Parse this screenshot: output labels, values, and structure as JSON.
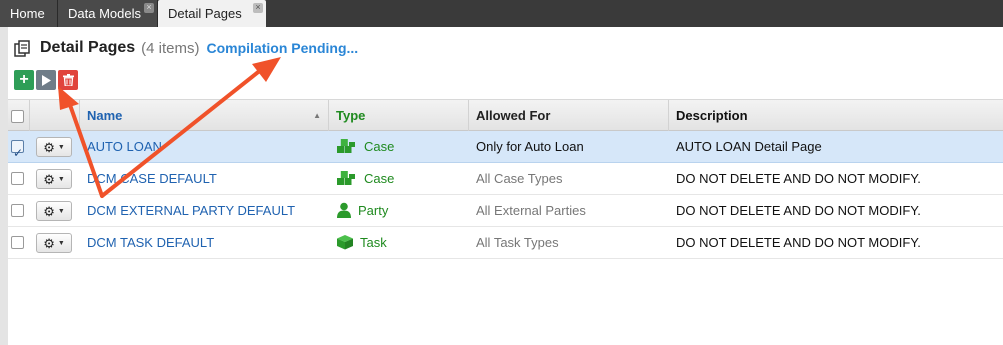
{
  "tabs": [
    {
      "label": "Home"
    },
    {
      "label": "Data Models"
    },
    {
      "label": "Detail Pages"
    }
  ],
  "header": {
    "title": "Detail Pages",
    "count": "(4 items)",
    "status_link": "Compilation Pending..."
  },
  "toolbar": {
    "add_icon": "plus-icon",
    "run_icon": "play-icon",
    "delete_icon": "trash-icon"
  },
  "columns": {
    "name": "Name",
    "type": "Type",
    "allowed": "Allowed For",
    "description": "Description"
  },
  "rows": [
    {
      "name": "AUTO LOAN",
      "type": "Case",
      "type_icon": "cubes-icon",
      "allowed": "Only for Auto Loan",
      "description": "AUTO LOAN Detail Page",
      "checked": true
    },
    {
      "name": "DCM CASE DEFAULT",
      "type": "Case",
      "type_icon": "cubes-icon",
      "allowed": "All Case Types",
      "description": "DO NOT DELETE AND DO NOT MODIFY.",
      "checked": false
    },
    {
      "name": "DCM EXTERNAL PARTY DEFAULT",
      "type": "Party",
      "type_icon": "person-icon",
      "allowed": "All External Parties",
      "description": "DO NOT DELETE AND DO NOT MODIFY.",
      "checked": false
    },
    {
      "name": "DCM TASK DEFAULT",
      "type": "Task",
      "type_icon": "cube-icon",
      "allowed": "All Task Types",
      "description": "DO NOT DELETE AND DO NOT MODIFY.",
      "checked": false
    }
  ],
  "colors": {
    "link_blue": "#1f62b0",
    "type_green": "#1f8a1f",
    "status_blue": "#2a86d6",
    "annotation_arrow": "#f0522a",
    "selected_row": "#d6e7f9"
  }
}
